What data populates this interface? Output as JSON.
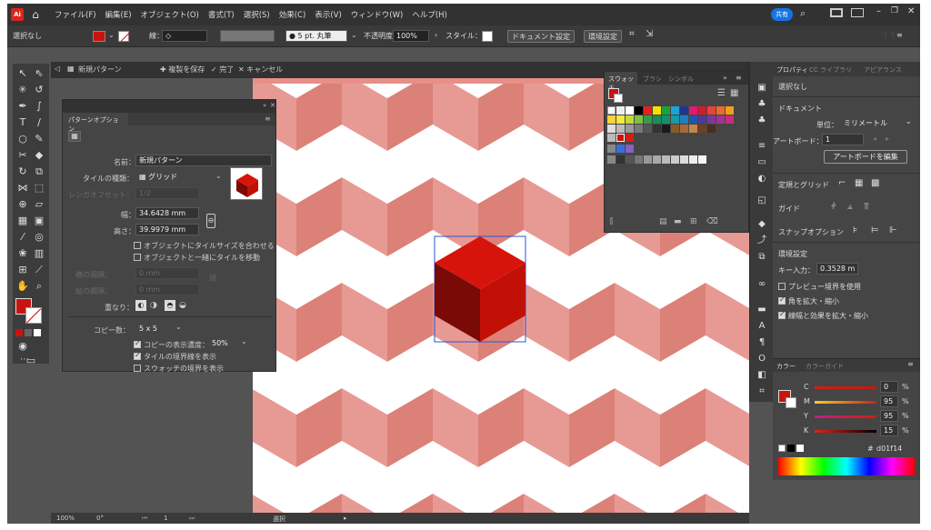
{
  "app": {
    "logo": "Ai"
  },
  "menu": [
    "ファイル(F)",
    "編集(E)",
    "オブジェクト(O)",
    "書式(T)",
    "選択(S)",
    "効果(C)",
    "表示(V)",
    "ウィンドウ(W)",
    "ヘルプ(H)"
  ],
  "share_label": "共有",
  "control": {
    "selection": "選択なし",
    "stroke_label": "線：",
    "brush": "● 5 pt. 丸筆",
    "opacity_label": "不透明度：",
    "opacity": "100%",
    "style_label": "スタイル：",
    "doc_settings": "ドキュメント設定",
    "prefs": "環境設定"
  },
  "tabbar": {
    "doc": "新規パターン",
    "save": "✚ 複製を保存",
    "done": "✓ 完了",
    "cancel": "✕ キャンセル"
  },
  "pattern_options": {
    "tab": "パターンオプション",
    "name_label": "名前：",
    "name": "新規パターン",
    "tile_type_label": "タイルの種類：",
    "tile_type": "▦ グリッド",
    "brick_offset_label": "レンガオフセット：",
    "brick_offset": "1/2",
    "width_label": "幅：",
    "width": "34.6428 mm",
    "height_label": "高さ：",
    "height": "39.9979 mm",
    "fit_tile": "オブジェクトにタイルサイズを合わせる",
    "move_tile": "オブジェクトと一緒にタイルを移動",
    "h_spacing_label": "横の間隔：",
    "h_spacing": "0 mm",
    "v_spacing_label": "縦の間隔：",
    "v_spacing": "0 mm",
    "overlap_label": "重なり：",
    "copies_label": "コピー数：",
    "copies": "5 x 5",
    "dim_copies": "コピーの表示濃度：",
    "dim_value": "50%",
    "show_tile_edge": "タイルの境界線を表示",
    "show_swatch_bounds": "スウォッチの境界を表示"
  },
  "swatches_panel": {
    "tabs": [
      "スウォッチ",
      "ブラシ",
      "シンボル"
    ]
  },
  "properties": {
    "tabs": [
      "プロパティ",
      "CC ライブラリ",
      "アピアランス"
    ],
    "no_selection": "選択なし",
    "document": "ドキュメント",
    "units_label": "単位：",
    "units": "ミリメートル",
    "artboard_label": "アートボード：",
    "artboard": "1",
    "edit_artboard": "アートボードを編集",
    "rulers_grids": "定規とグリッド",
    "guides": "ガイド",
    "snap": "スナップオプション",
    "prefs": "環境設定",
    "key_label": "キー入力：",
    "key_value": "0.3528 m",
    "preview_bounds": "プレビュー境界を使用",
    "scale_corners": "角を拡大・縮小",
    "scale_strokes": "線幅と効果を拡大・縮小"
  },
  "color_panel": {
    "tabs": [
      "カラー",
      "カラーガイド"
    ],
    "channels": [
      {
        "label": "C",
        "value": "0",
        "unit": "%"
      },
      {
        "label": "M",
        "value": "95",
        "unit": "%"
      },
      {
        "label": "Y",
        "value": "95",
        "unit": "%"
      },
      {
        "label": "K",
        "value": "15",
        "unit": "%"
      }
    ],
    "hex": "d01f14"
  },
  "status": {
    "zoom": "100%",
    "rotate": "0°",
    "page": "1",
    "mode": "選択"
  },
  "colors": {
    "accent": "#c8140f",
    "cube_front": "#c61107",
    "cube_side": "#8a0c05",
    "pattern_top": "#e8a29b",
    "pattern_side": "#d97a72"
  }
}
